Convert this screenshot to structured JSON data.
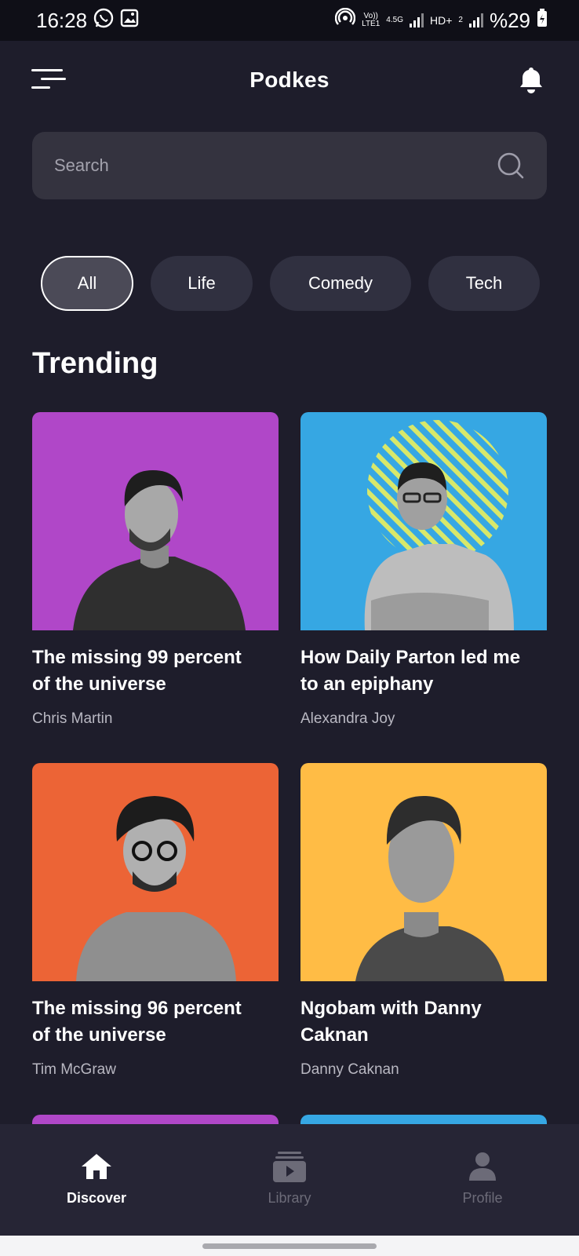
{
  "status_bar": {
    "time": "16:28",
    "volte": "Vo))",
    "lte": "LTE1",
    "network": "4.5G",
    "hd": "HD+",
    "sim2": "2",
    "battery": "%29"
  },
  "header": {
    "title": "Podkes"
  },
  "search": {
    "placeholder": "Search"
  },
  "categories": [
    {
      "label": "All",
      "active": true
    },
    {
      "label": "Life",
      "active": false
    },
    {
      "label": "Comedy",
      "active": false
    },
    {
      "label": "Tech",
      "active": false
    }
  ],
  "trending": {
    "title": "Trending",
    "items": [
      {
        "title_line1": "The missing 99 percent",
        "title_line2": "of the universe",
        "author": "Chris Martin",
        "bg_color": "#b047c8"
      },
      {
        "title_line1": "How Daily Parton led me",
        "title_line2": "to an epiphany",
        "author": "Alexandra Joy",
        "bg_color": "#36a7e3"
      },
      {
        "title_line1": "The missing 96 percent",
        "title_line2": "of the universe",
        "author": "Tim McGraw",
        "bg_color": "#ec6436"
      },
      {
        "title_line1": "Ngobam with Danny",
        "title_line2": "Caknan",
        "author": "Danny Caknan",
        "bg_color": "#ffbc45"
      }
    ]
  },
  "bottom_nav": {
    "items": [
      {
        "label": "Discover",
        "icon": "home-icon",
        "active": true
      },
      {
        "label": "Library",
        "icon": "library-icon",
        "active": false
      },
      {
        "label": "Profile",
        "icon": "profile-icon",
        "active": false
      }
    ]
  },
  "colors": {
    "background": "#1e1d2b",
    "surface": "#34333f",
    "chip": "#303040",
    "nav": "#262535"
  }
}
